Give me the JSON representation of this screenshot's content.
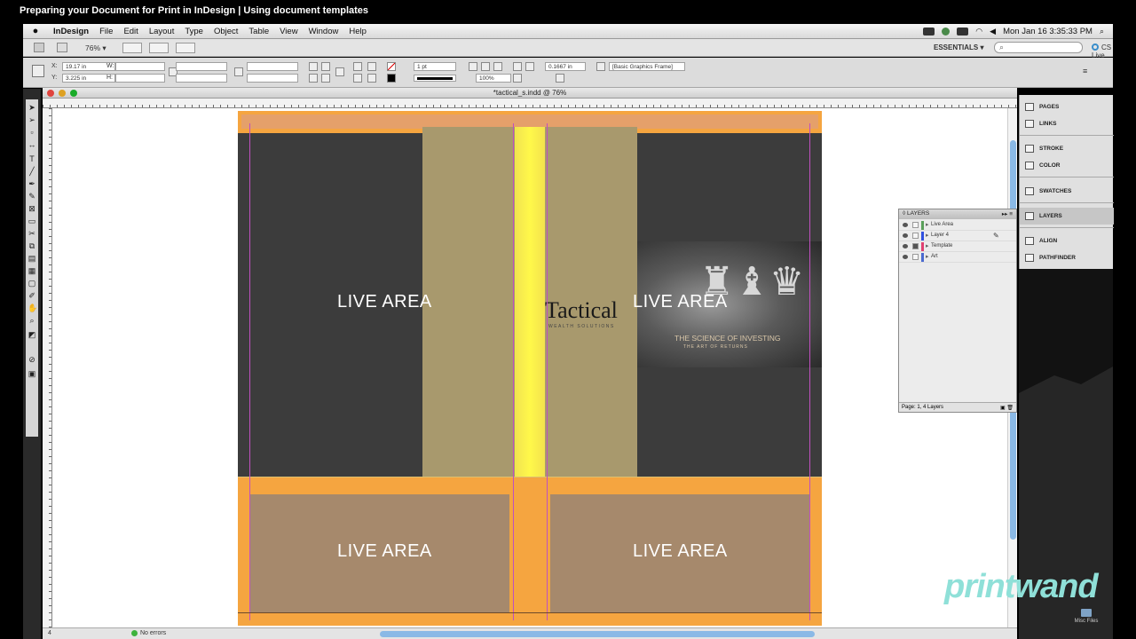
{
  "video": {
    "title": "Preparing your Document for Print in InDesign | Using document templates"
  },
  "menubar": {
    "apple": "",
    "app_name": "InDesign",
    "items": [
      "File",
      "Edit",
      "Layout",
      "Type",
      "Object",
      "Table",
      "View",
      "Window",
      "Help"
    ],
    "clock": "Mon Jan 16  3:35:33 PM"
  },
  "appbar": {
    "zoom": "76%",
    "workspace": "ESSENTIALS",
    "search_placeholder": "",
    "cs_live": "CS Live"
  },
  "control": {
    "x_label": "X:",
    "x_value": "19.17 in",
    "y_label": "Y:",
    "y_value": "3.225 in",
    "w_label": "W:",
    "h_label": "H:",
    "stroke_weight": "1 pt",
    "scale_pct": "100%",
    "offset": "0.1667 in",
    "object_style": "[Basic Graphics Frame]"
  },
  "document": {
    "tab_title": "*tactical_s.indd @ 76%",
    "status_page": "4",
    "status_errors": "No errors"
  },
  "artboard": {
    "live_labels": [
      "LIVE AREA",
      "LIVE AREA",
      "LIVE AREA",
      "LIVE AREA"
    ],
    "logo": "Tactical",
    "logo_sub": "WEALTH SOLUTIONS",
    "photo_title": "THE SCIENCE OF INVESTING",
    "photo_sub": "THE ART OF RETURNS"
  },
  "layers_panel": {
    "title": "LAYERS",
    "layers": [
      {
        "name": "Live Area",
        "color": "#5aa05a"
      },
      {
        "name": "Layer 4",
        "color": "#3050e0"
      },
      {
        "name": "Template",
        "color": "#e04070"
      },
      {
        "name": "Art",
        "color": "#4a6ad0"
      }
    ],
    "footer": "Page: 1, 4 Layers"
  },
  "dock": {
    "items": [
      "PAGES",
      "LINKS",
      "STROKE",
      "COLOR",
      "SWATCHES",
      "LAYERS",
      "ALIGN",
      "PATHFINDER"
    ],
    "selected": "LAYERS"
  },
  "branding": {
    "watermark": "printwand",
    "misc_files": "Misc Files"
  }
}
